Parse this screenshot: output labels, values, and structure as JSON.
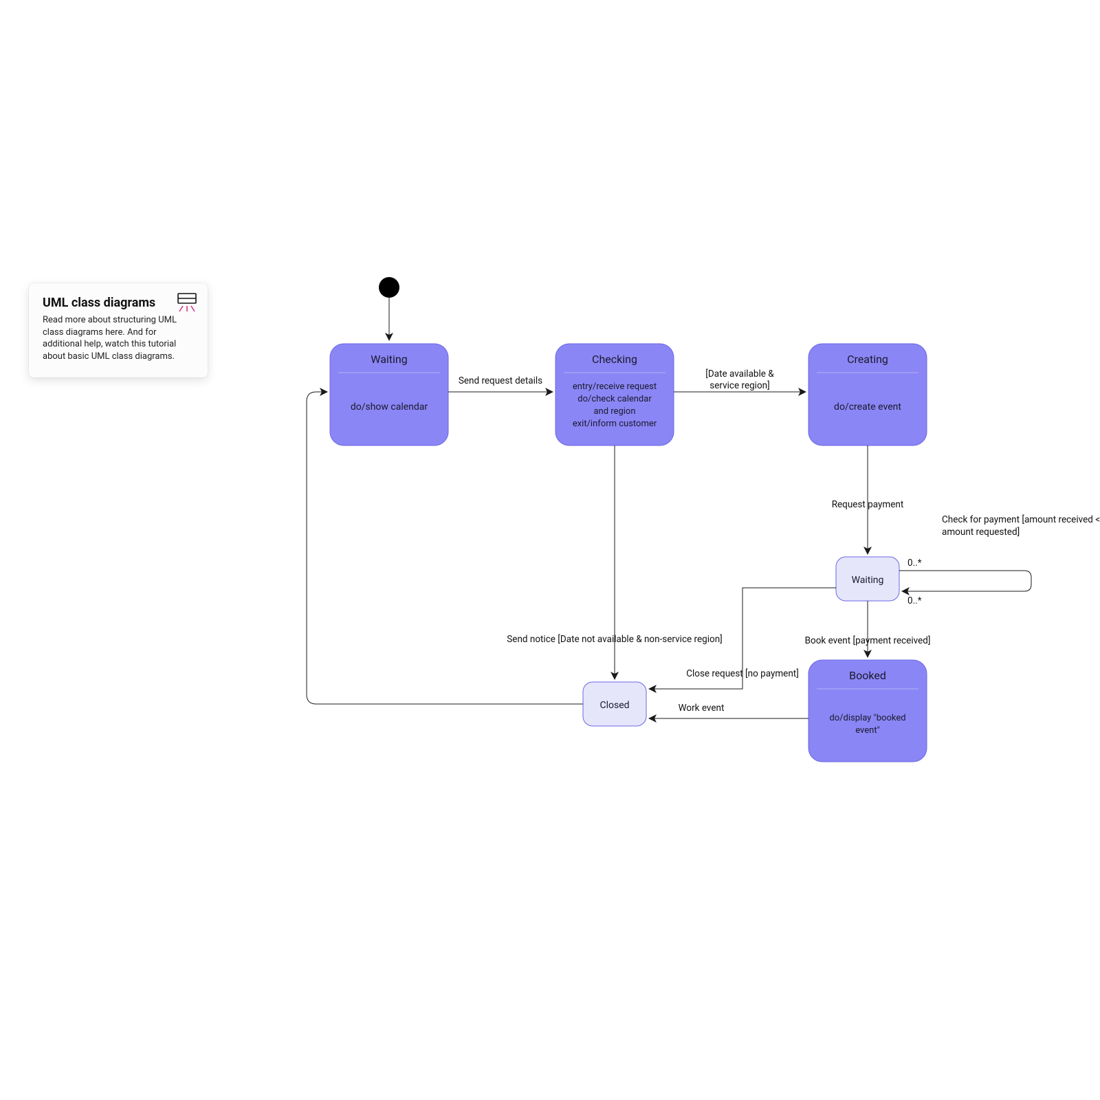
{
  "infocard": {
    "title": "UML class diagrams",
    "body": "Read more about structuring UML class diagrams here. And for additional help, watch this tutorial about basic UML class diagrams."
  },
  "states": {
    "waiting": {
      "title": "Waiting",
      "body": "do/show calendar"
    },
    "checking": {
      "title": "Checking",
      "l1": "entry/receive request",
      "l2": "do/check calendar",
      "l3": "and region",
      "l4": "exit/inform customer"
    },
    "creating": {
      "title": "Creating",
      "body": "do/create event"
    },
    "waiting2": {
      "title": "Waiting"
    },
    "closed": {
      "title": "Closed"
    },
    "booked": {
      "title": "Booked",
      "l1": "do/display \"booked",
      "l2": "event\""
    }
  },
  "edges": {
    "send_request": "Send request details",
    "date_avail_1": "[Date available &",
    "date_avail_2": "service region]",
    "req_payment": "Request payment",
    "check_payment_1": "Check for payment [amount received <",
    "check_payment_2": "amount requested]",
    "book_event": "Book event [payment received]",
    "send_notice": "Send notice [Date not available & non-service region]",
    "close_req": "Close request [no payment]",
    "work_event": "Work event",
    "mult1": "0..*",
    "mult2": "0..*"
  }
}
